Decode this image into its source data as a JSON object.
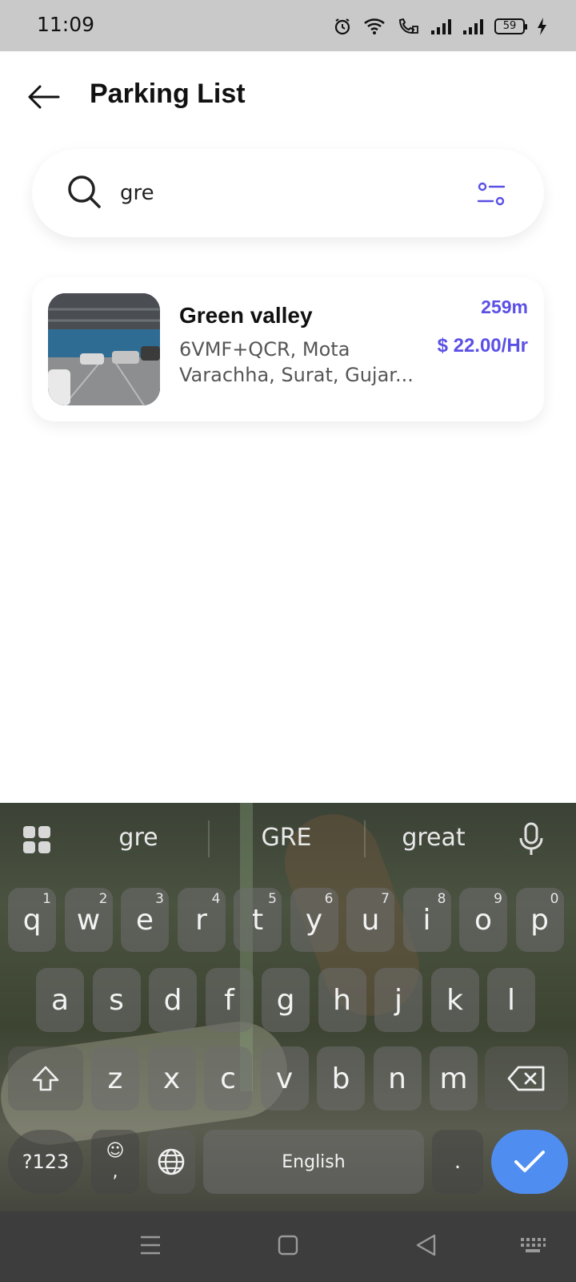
{
  "status_bar": {
    "time": "11:09",
    "battery": "59",
    "icons": [
      "alarm-icon",
      "wifi-icon",
      "volte-call-icon",
      "signal-icon",
      "signal-icon",
      "battery-icon",
      "charging-icon"
    ]
  },
  "header": {
    "back_icon": "arrow-left-icon",
    "title": "Parking List"
  },
  "search": {
    "value": "gre",
    "icon": "search-icon",
    "filter_icon": "filter-icon"
  },
  "results": [
    {
      "name": "Green valley",
      "address": "6VMF+QCR, Mota Varachha, Surat, Gujar...",
      "distance": "259m",
      "price": "$ 22.00/Hr"
    }
  ],
  "keyboard": {
    "suggestions": [
      "gre",
      "GRE",
      "great"
    ],
    "row1": [
      {
        "letter": "q",
        "num": "1"
      },
      {
        "letter": "w",
        "num": "2"
      },
      {
        "letter": "e",
        "num": "3"
      },
      {
        "letter": "r",
        "num": "4"
      },
      {
        "letter": "t",
        "num": "5"
      },
      {
        "letter": "y",
        "num": "6"
      },
      {
        "letter": "u",
        "num": "7"
      },
      {
        "letter": "i",
        "num": "8"
      },
      {
        "letter": "o",
        "num": "9"
      },
      {
        "letter": "p",
        "num": "0"
      }
    ],
    "row2": [
      "a",
      "s",
      "d",
      "f",
      "g",
      "h",
      "j",
      "k",
      "l"
    ],
    "row3": [
      "z",
      "x",
      "c",
      "v",
      "b",
      "n",
      "m"
    ],
    "symbols_label": "?123",
    "emoji_label": "☺",
    "comma_label": ",",
    "space_label": "English",
    "period_label": "."
  },
  "colors": {
    "accent": "#5b50e6",
    "done_key": "#4f8ef0"
  }
}
